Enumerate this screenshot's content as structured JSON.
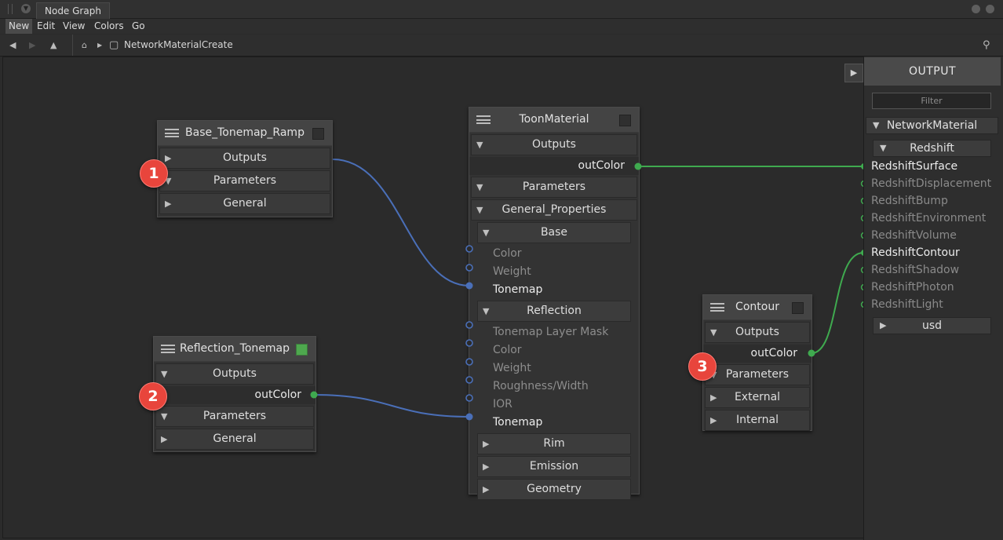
{
  "window": {
    "tab_title": "Node Graph"
  },
  "menu": [
    "New",
    "Edit",
    "View",
    "Colors",
    "Go"
  ],
  "toolbar": {
    "path": "NetworkMaterialCreate"
  },
  "nodes": {
    "base_tonemap_ramp": {
      "title": "Base_Tonemap_Ramp",
      "sections": [
        "Outputs",
        "Parameters",
        "General"
      ]
    },
    "reflection_tonemap": {
      "title": "Reflection_Tonemap",
      "outputs_label": "Outputs",
      "out_port": "outColor",
      "sections": [
        "Parameters",
        "General"
      ]
    },
    "toon_material": {
      "title": "ToonMaterial",
      "outputs_label": "Outputs",
      "out_port": "outColor",
      "parameters_label": "Parameters",
      "general_label": "General_Properties",
      "base_label": "Base",
      "base_ports": [
        "Color",
        "Weight",
        "Tonemap"
      ],
      "reflection_label": "Reflection",
      "reflection_ports": [
        "Tonemap Layer Mask",
        "Color",
        "Weight",
        "Roughness/Width",
        "IOR",
        "Tonemap"
      ],
      "collapsed": [
        "Rim",
        "Emission",
        "Geometry"
      ]
    },
    "contour": {
      "title": "Contour",
      "outputs_label": "Outputs",
      "out_port": "outColor",
      "sections": [
        "Parameters",
        "External",
        "Internal"
      ]
    }
  },
  "output_panel": {
    "title": "OUTPUT",
    "filter_placeholder": "Filter",
    "network": "NetworkMaterial",
    "group": "Redshift",
    "shaders": [
      "RedshiftSurface",
      "RedshiftDisplacement",
      "RedshiftBump",
      "RedshiftEnvironment",
      "RedshiftVolume",
      "RedshiftContour",
      "RedshiftShadow",
      "RedshiftPhoton",
      "RedshiftLight"
    ],
    "connected_shaders": [
      "RedshiftSurface",
      "RedshiftContour"
    ],
    "usd": "usd"
  },
  "callouts": [
    "1",
    "2",
    "3"
  ],
  "colors": {
    "blue_wire": "#4a6fb8",
    "green_wire": "#3faa4f",
    "callout": "#e8453c",
    "enabled_check": "#4ea84e"
  }
}
